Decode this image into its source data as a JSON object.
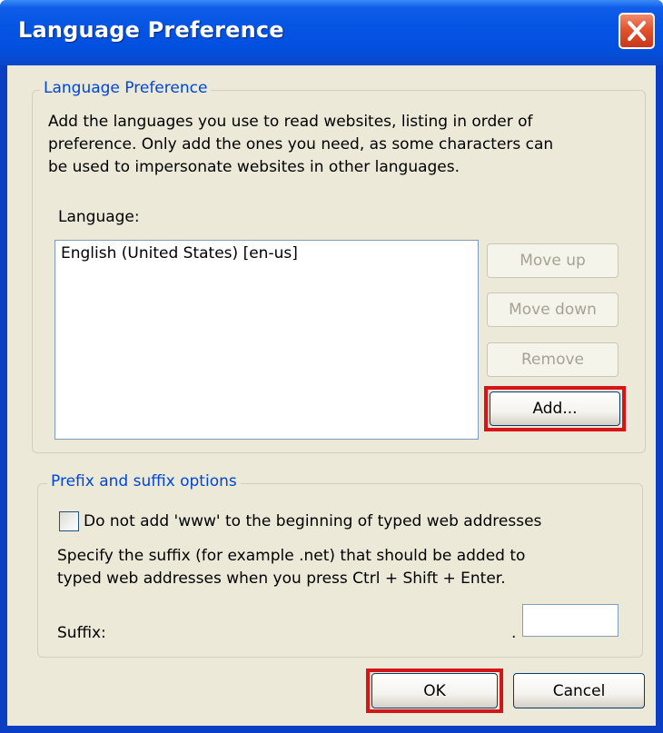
{
  "window": {
    "title": "Language Preference",
    "close_icon": "close-icon"
  },
  "language_group": {
    "title": "Language Preference",
    "description_line1": "Add the languages you use to read websites, listing in order of",
    "description_line2": "preference. Only add the ones you need, as some characters can",
    "description_line3": "be used to impersonate websites in other languages.",
    "list_label": "Language:",
    "languages": [
      "English (United States) [en-us]"
    ],
    "buttons": {
      "move_up": "Move up",
      "move_down": "Move down",
      "remove": "Remove",
      "add": "Add..."
    }
  },
  "prefix_group": {
    "title": "Prefix and suffix options",
    "checkbox_label": "Do not add 'www' to the beginning of typed web addresses",
    "checkbox_checked": false,
    "suffix_desc_line1": "Specify the suffix (for example .net) that should be added to",
    "suffix_desc_line2": "typed web addresses when you press Ctrl + Shift + Enter.",
    "suffix_label": "Suffix:",
    "suffix_dot": ".",
    "suffix_value": ""
  },
  "footer": {
    "ok": "OK",
    "cancel": "Cancel"
  },
  "colors": {
    "titlebar": "#0554e3",
    "highlight": "#d61519",
    "group_title": "#0046d5",
    "dialog_bg": "#ece9d8"
  }
}
